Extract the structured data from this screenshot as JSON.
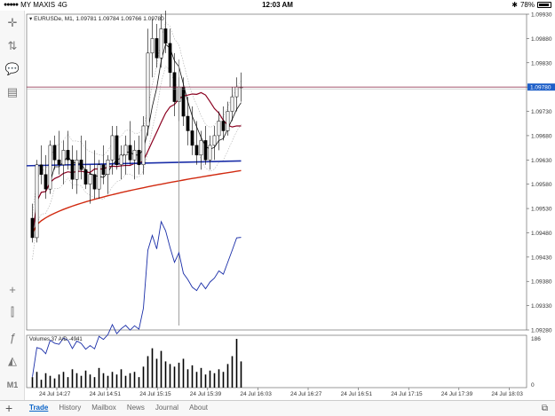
{
  "status_bar": {
    "carrier": "MY MAXIS",
    "network": "4G",
    "time": "12:03 AM",
    "battery": "78%",
    "battery_level": 0.78
  },
  "toolbar": {
    "icons": [
      "crosshair-icon",
      "trade-icon",
      "chat-icon",
      "document-icon",
      "crosshair-tool-icon",
      "candles-icon",
      "function-icon",
      "objects-icon",
      "timeframe-icon"
    ],
    "timeframe_label": "M1"
  },
  "chart": {
    "header": "EURUSDe, M1, 1.09781 1.09784 1.09766 1.09780",
    "current_price": "1.09780",
    "indicator_label": "Volumes 37 A/D -4941",
    "indicator_max": "186",
    "indicator_min": "0"
  },
  "chart_data": {
    "type": "candlestick",
    "symbol": "EURUSDe",
    "timeframe": "M1",
    "ylim": [
      1.0928,
      1.0993
    ],
    "price_ticks": [
      "1.09930",
      "1.09880",
      "1.09830",
      "1.09780",
      "1.09730",
      "1.09680",
      "1.09630",
      "1.09580",
      "1.09530",
      "1.09480",
      "1.09430",
      "1.09380",
      "1.09330",
      "1.09280"
    ],
    "time_ticks": [
      "24 Jul 14:27",
      "24 Jul 14:51",
      "24 Jul 15:15",
      "24 Jul 15:39",
      "24 Jul 16:03",
      "24 Jul 16:27",
      "24 Jul 16:51",
      "24 Jul 17:15",
      "24 Jul 17:39",
      "24 Jul 18:03"
    ],
    "last_price": 1.0978,
    "candles": [
      [
        1.0951,
        1.0954,
        1.0946,
        1.0947
      ],
      [
        1.0947,
        1.0963,
        1.0946,
        1.0962
      ],
      [
        1.0962,
        1.0966,
        1.0958,
        1.096
      ],
      [
        1.096,
        1.0964,
        1.0955,
        1.0957
      ],
      [
        1.0957,
        1.0967,
        1.0956,
        1.0966
      ],
      [
        1.0966,
        1.0968,
        1.0961,
        1.0963
      ],
      [
        1.0963,
        1.0969,
        1.096,
        1.0962
      ],
      [
        1.0962,
        1.0967,
        1.0958,
        1.0965
      ],
      [
        1.0965,
        1.0969,
        1.0961,
        1.0963
      ],
      [
        1.0963,
        1.0966,
        1.0957,
        1.0959
      ],
      [
        1.0959,
        1.0965,
        1.0956,
        1.0963
      ],
      [
        1.0963,
        1.0968,
        1.0959,
        1.0961
      ],
      [
        1.0961,
        1.0967,
        1.0957,
        1.0958
      ],
      [
        1.0958,
        1.0962,
        1.0954,
        1.096
      ],
      [
        1.096,
        1.0965,
        1.0955,
        1.0957
      ],
      [
        1.0957,
        1.0963,
        1.0955,
        1.0962
      ],
      [
        1.0962,
        1.0966,
        1.0958,
        1.096
      ],
      [
        1.096,
        1.0964,
        1.0956,
        1.0963
      ],
      [
        1.0963,
        1.097,
        1.096,
        1.0968
      ],
      [
        1.0968,
        1.097,
        1.0961,
        1.0962
      ],
      [
        1.0962,
        1.0966,
        1.0959,
        1.0964
      ],
      [
        1.0964,
        1.0968,
        1.096,
        1.0966
      ],
      [
        1.0966,
        1.0971,
        1.0962,
        1.0963
      ],
      [
        1.0963,
        1.0967,
        1.0959,
        1.0965
      ],
      [
        1.0965,
        1.0968,
        1.096,
        1.0962
      ],
      [
        1.0962,
        1.0972,
        1.096,
        1.097
      ],
      [
        1.097,
        1.099,
        1.0968,
        1.0985
      ],
      [
        1.0985,
        1.0992,
        1.098,
        1.0988
      ],
      [
        1.0988,
        1.0991,
        1.0982,
        1.0984
      ],
      [
        1.0984,
        1.0993,
        1.0982,
        1.099
      ],
      [
        1.099,
        1.0994,
        1.0985,
        1.0987
      ],
      [
        1.0987,
        1.099,
        1.0978,
        1.0981
      ],
      [
        1.0981,
        1.0985,
        1.0972,
        1.0975
      ],
      [
        1.0975,
        1.098,
        1.0971,
        1.0978
      ],
      [
        1.0978,
        1.098,
        1.097,
        1.0972
      ],
      [
        1.0972,
        1.0976,
        1.0966,
        1.0969
      ],
      [
        1.0969,
        1.0974,
        1.0964,
        1.0966
      ],
      [
        1.0966,
        1.0971,
        1.0962,
        1.0964
      ],
      [
        1.0964,
        1.0969,
        1.0961,
        1.0967
      ],
      [
        1.0967,
        1.097,
        1.0962,
        1.0963
      ],
      [
        1.0963,
        1.0968,
        1.0961,
        1.0966
      ],
      [
        1.0966,
        1.097,
        1.0963,
        1.0968
      ],
      [
        1.0968,
        1.0973,
        1.0965,
        1.0971
      ],
      [
        1.0971,
        1.0974,
        1.0967,
        1.0969
      ],
      [
        1.0969,
        1.0975,
        1.0968,
        1.0973
      ],
      [
        1.0973,
        1.0978,
        1.0971,
        1.0976
      ],
      [
        1.0976,
        1.098,
        1.0973,
        1.0978
      ],
      [
        1.0978,
        1.0981,
        1.0975,
        1.0978
      ]
    ],
    "volumes": [
      40,
      60,
      30,
      55,
      45,
      35,
      50,
      60,
      40,
      70,
      55,
      45,
      65,
      50,
      40,
      75,
      55,
      45,
      60,
      50,
      70,
      45,
      55,
      60,
      40,
      80,
      120,
      150,
      110,
      140,
      100,
      90,
      80,
      95,
      110,
      70,
      85,
      60,
      75,
      50,
      65,
      55,
      70,
      60,
      90,
      120,
      186,
      100
    ]
  },
  "tabs": {
    "items": [
      "Trade",
      "History",
      "Mailbox",
      "News",
      "Journal",
      "About"
    ]
  }
}
